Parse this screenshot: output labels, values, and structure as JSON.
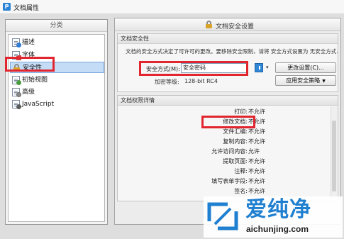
{
  "window": {
    "title": "文档属性",
    "icon": "P"
  },
  "left_panel": {
    "header": "分类",
    "items": [
      {
        "label": "描述",
        "icon": "document-info-icon",
        "selected": false
      },
      {
        "label": "字体",
        "icon": "document-font-icon",
        "selected": false
      },
      {
        "label": "安全性",
        "icon": "lock-icon",
        "selected": true
      },
      {
        "label": "初始视图",
        "icon": "document-view-icon",
        "selected": false
      },
      {
        "label": "高级",
        "icon": "document-gear-icon",
        "selected": false
      },
      {
        "label": "JavaScript",
        "icon": "document-script-icon",
        "selected": false
      }
    ]
  },
  "right_panel": {
    "header": "文档安全设置",
    "security_group": {
      "title": "文档安全性",
      "description": "文档的安全方式决定了可许可的更改。要移除安全限制，请将 安全方式设置为 无安全方式.",
      "method_label": "安全方式(M):",
      "method_value": "安全密码",
      "level_label": "加密等级:",
      "level_value": "128-bit RC4",
      "change_settings_button": "更改设置(C)...",
      "apply_policy_button": "应用安全策略"
    },
    "permissions_group": {
      "title": "文档权限详情",
      "rows": [
        {
          "name": "打印:",
          "value": "不允许"
        },
        {
          "name": "修改文档:",
          "value": "不允许"
        },
        {
          "name": "文件汇编:",
          "value": "不允许"
        },
        {
          "name": "复制内容:",
          "value": "不允许"
        },
        {
          "name": "允许访问内容:",
          "value": "允许"
        },
        {
          "name": "提取页面:",
          "value": "不允许"
        },
        {
          "name": "注释:",
          "value": "不允许"
        },
        {
          "name": "填写表单字段:",
          "value": "不允许"
        },
        {
          "name": "签名:",
          "value": "不允许"
        }
      ]
    }
  },
  "watermark": {
    "brand": "爱纯净",
    "url": "aichunjing.com"
  },
  "colors": {
    "accent": "#2a82d6",
    "highlight_box": "#e1262f",
    "selection": "#c5dcf6",
    "watermark": "#1f7fd0"
  }
}
